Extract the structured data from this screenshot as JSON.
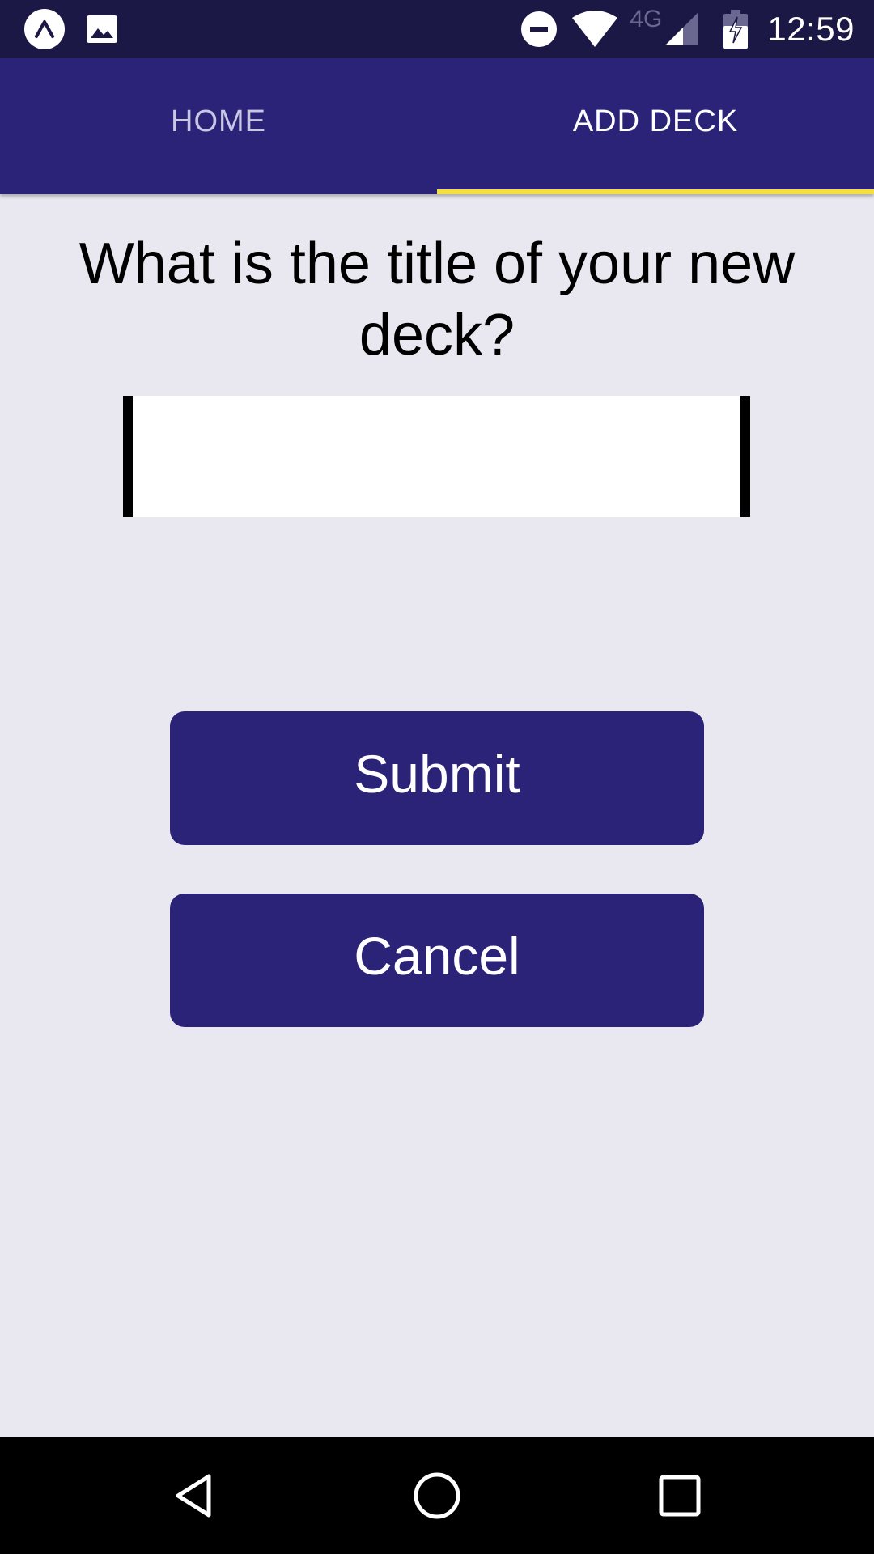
{
  "status_bar": {
    "network_type": "4G",
    "time": "12:59"
  },
  "tabs": [
    {
      "label": "HOME",
      "active": false
    },
    {
      "label": "ADD DECK",
      "active": true
    }
  ],
  "colors": {
    "status_bar_bg": "#1c1845",
    "header_bg": "#2a2378",
    "tab_indicator": "#f3e03c",
    "page_bg": "#e9e8f0",
    "button_bg": "#2a2378"
  },
  "form": {
    "question": "What is the title of your new deck?",
    "title_input": {
      "value": "",
      "placeholder": ""
    },
    "submit_label": "Submit",
    "cancel_label": "Cancel"
  },
  "icons": {
    "status_left": [
      "expo-icon",
      "image-icon"
    ],
    "status_right": [
      "do-not-disturb-icon",
      "wifi-icon",
      "signal-icon",
      "battery-charging-icon"
    ],
    "nav": [
      "back-icon",
      "home-icon",
      "recents-icon"
    ]
  }
}
